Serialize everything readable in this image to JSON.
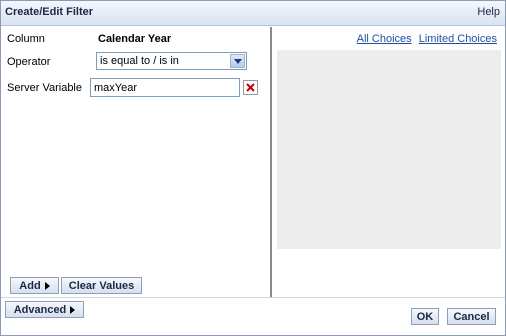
{
  "dialog": {
    "title": "Create/Edit Filter",
    "help_label": "Help"
  },
  "form": {
    "column_label": "Column",
    "column_value": "Calendar Year",
    "operator_label": "Operator",
    "operator_value": "is equal to / is in",
    "server_variable_label": "Server Variable",
    "server_variable_value": "maxYear"
  },
  "choices": {
    "all_choices_label": "All Choices",
    "limited_choices_label": "Limited Choices"
  },
  "buttons": {
    "add_label": "Add",
    "clear_values_label": "Clear Values",
    "advanced_label": "Advanced",
    "ok_label": "OK",
    "cancel_label": "Cancel"
  },
  "colors": {
    "titlebar_start": "#f4f7fc",
    "titlebar_end": "#d9e3f1",
    "link": "#1f4fa3",
    "clear_x": "#cc0000",
    "choices_panel": "#ededed"
  }
}
